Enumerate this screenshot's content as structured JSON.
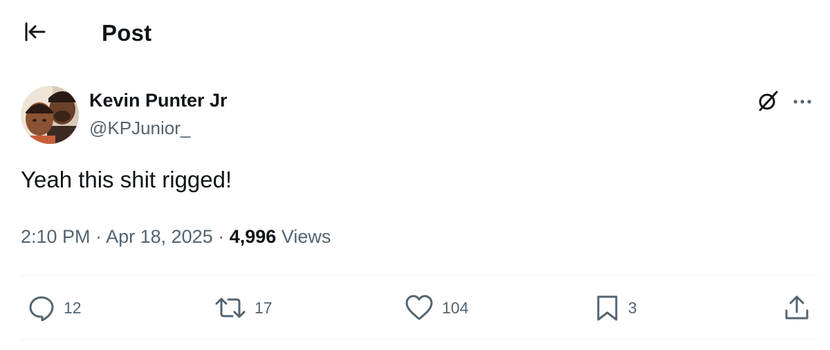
{
  "header": {
    "title": "Post",
    "back_icon": "arrow-left-to-line-icon"
  },
  "author": {
    "name": "Kevin Punter Jr",
    "handle": "@KPJunior_",
    "avatar_icon": "profile-photo"
  },
  "post": {
    "text": "Yeah this shit rigged!",
    "time": "2:10 PM",
    "separator": "·",
    "date": "Apr 18, 2025",
    "views_count": "4,996",
    "views_label": "Views"
  },
  "actions": {
    "reply": {
      "icon": "reply-icon",
      "count": "12"
    },
    "repost": {
      "icon": "repost-icon",
      "count": "17"
    },
    "like": {
      "icon": "heart-icon",
      "count": "104"
    },
    "bookmark": {
      "icon": "bookmark-icon",
      "count": "3"
    },
    "share": {
      "icon": "share-icon"
    }
  },
  "colors": {
    "text_primary": "#0f1419",
    "text_secondary": "#536471",
    "divider": "#eff3f4",
    "background": "#ffffff"
  }
}
